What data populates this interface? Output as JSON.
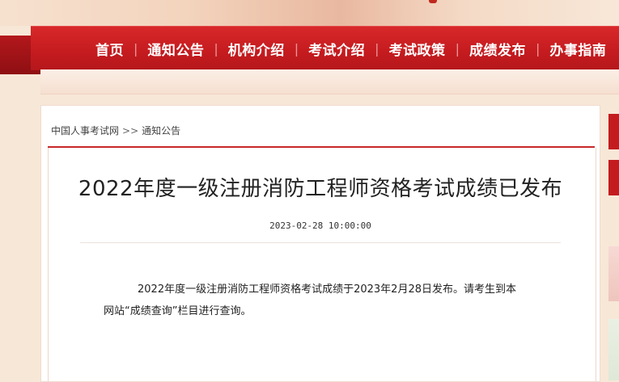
{
  "nav": {
    "items": [
      {
        "label": "首页"
      },
      {
        "label": "通知公告"
      },
      {
        "label": "机构介绍"
      },
      {
        "label": "考试介绍"
      },
      {
        "label": "考试政策"
      },
      {
        "label": "成绩发布"
      },
      {
        "label": "办事指南"
      }
    ],
    "separator": "|"
  },
  "breadcrumb": {
    "home": "中国人事考试网",
    "separator": ">>",
    "current": "通知公告"
  },
  "article": {
    "title": "2022年度一级注册消防工程师资格考试成绩已发布",
    "date": "2023-02-28 10:00:00",
    "body_line1": "2022年度一级注册消防工程师资格考试成绩于2023年2月28日发布。请考生到本",
    "body_line2": "网站“成绩查询”栏目进行查询。"
  },
  "colors": {
    "brand_red": "#c41b1f",
    "page_bg": "#f7e7d7"
  }
}
